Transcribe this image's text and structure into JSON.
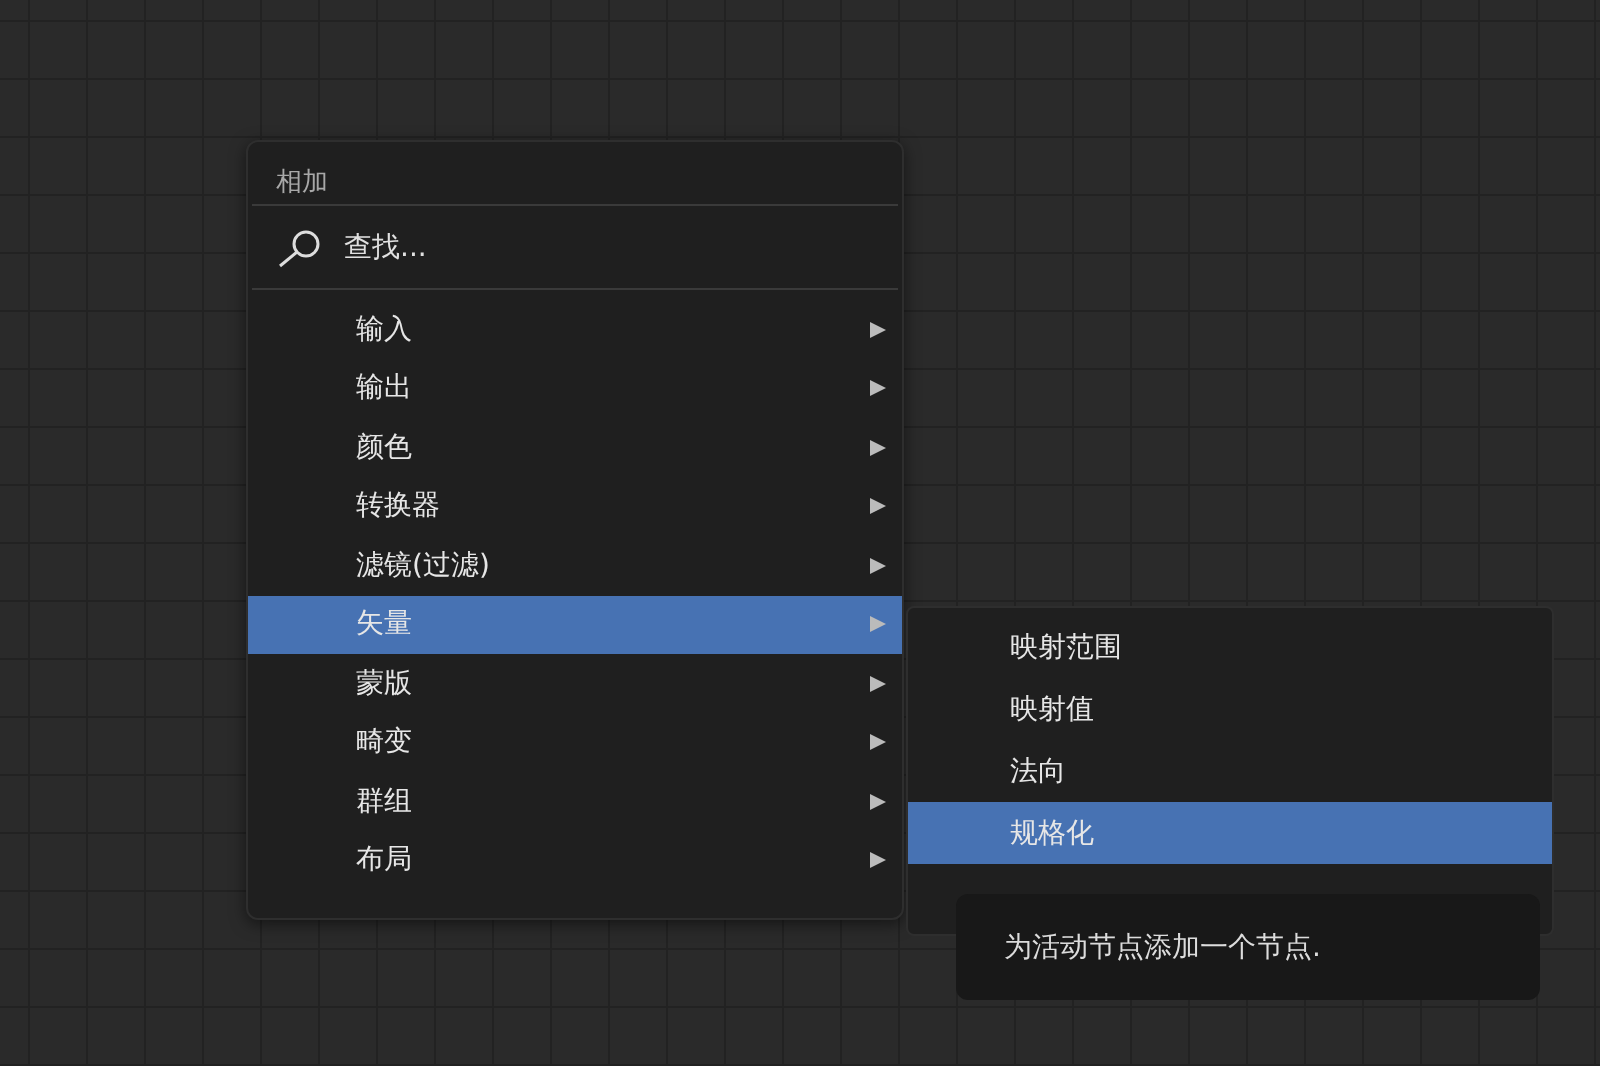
{
  "menu": {
    "title": "相加",
    "search": {
      "label": "查找..."
    },
    "items": [
      {
        "label": "输入",
        "selected": false
      },
      {
        "label": "输出",
        "selected": false
      },
      {
        "label": "颜色",
        "selected": false
      },
      {
        "label": "转换器",
        "selected": false
      },
      {
        "label": "滤镜(过滤)",
        "selected": false
      },
      {
        "label": "矢量",
        "selected": true
      },
      {
        "label": "蒙版",
        "selected": false
      },
      {
        "label": "畸变",
        "selected": false
      },
      {
        "label": "群组",
        "selected": false
      },
      {
        "label": "布局",
        "selected": false
      }
    ]
  },
  "submenu": {
    "items": [
      {
        "label": "映射范围",
        "selected": false
      },
      {
        "label": "映射值",
        "selected": false
      },
      {
        "label": "法向",
        "selected": false
      },
      {
        "label": "规格化",
        "selected": true
      }
    ]
  },
  "tooltip": {
    "text": "为活动节点添加一个节点."
  }
}
